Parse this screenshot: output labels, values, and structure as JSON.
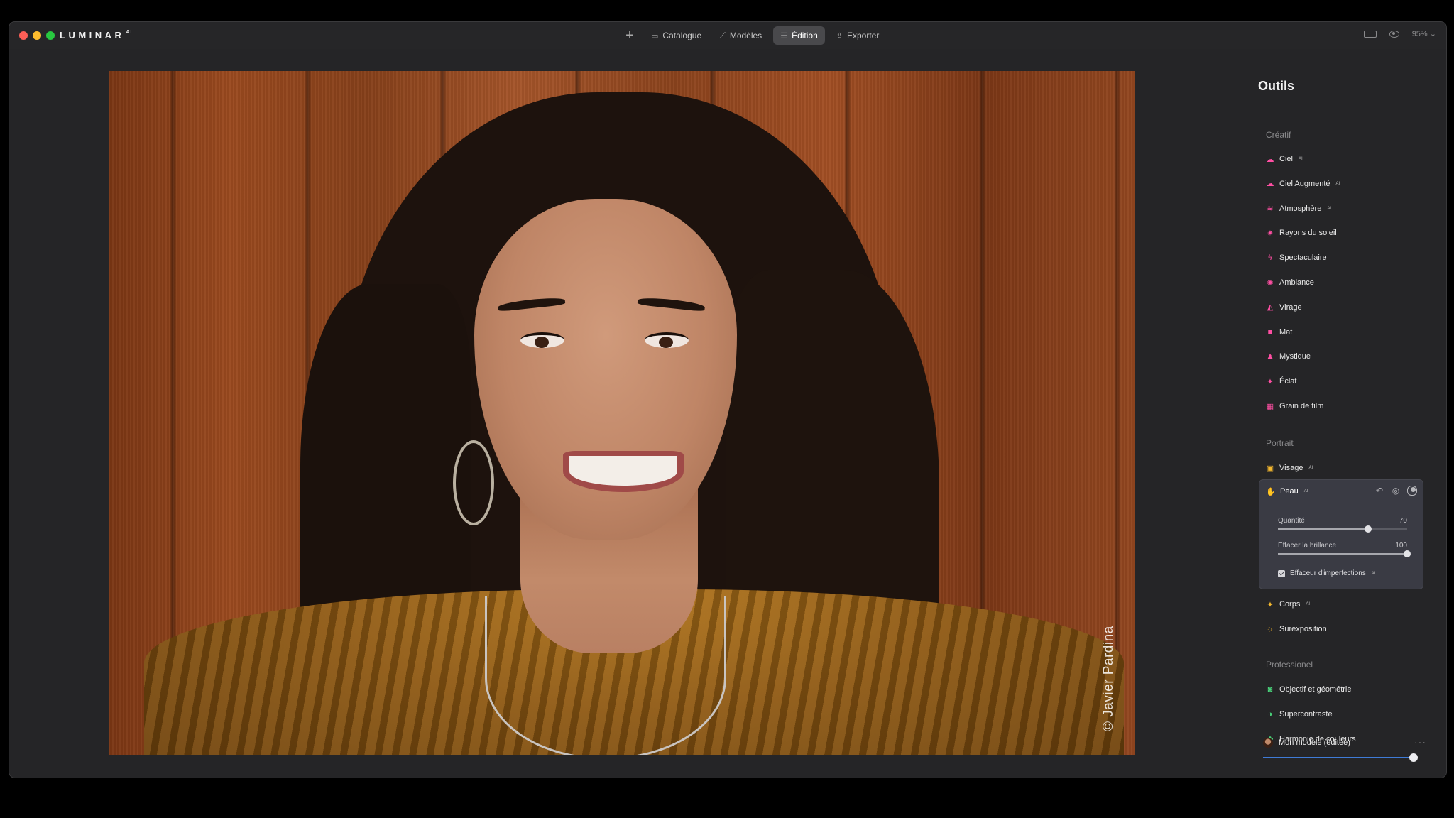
{
  "app": {
    "brand": "LUMINAR",
    "brand_suffix": "AI"
  },
  "topnav": {
    "items": [
      {
        "label": "Catalogue",
        "icon": "folder-icon"
      },
      {
        "label": "Modèles",
        "icon": "wand-icon"
      },
      {
        "label": "Édition",
        "icon": "sliders-icon",
        "active": true
      },
      {
        "label": "Exporter",
        "icon": "share-icon"
      }
    ],
    "zoom": "95%"
  },
  "photo": {
    "watermark": "© Javier Pardina"
  },
  "panel": {
    "title": "Outils",
    "sections": {
      "creatif": {
        "label": "Créatif",
        "items": [
          {
            "label": "Ciel",
            "ai": true,
            "color": "#ff4fa3"
          },
          {
            "label": "Ciel Augmenté",
            "ai": true,
            "color": "#ff4fa3"
          },
          {
            "label": "Atmosphère",
            "ai": true,
            "color": "#ff4fa3"
          },
          {
            "label": "Rayons du soleil",
            "ai": false,
            "color": "#ff4fa3"
          },
          {
            "label": "Spectaculaire",
            "ai": false,
            "color": "#ff4fa3"
          },
          {
            "label": "Ambiance",
            "ai": false,
            "color": "#ff4fa3"
          },
          {
            "label": "Virage",
            "ai": false,
            "color": "#ff4fa3"
          },
          {
            "label": "Mat",
            "ai": false,
            "color": "#ff4fa3"
          },
          {
            "label": "Mystique",
            "ai": false,
            "color": "#ff4fa3"
          },
          {
            "label": "Éclat",
            "ai": false,
            "color": "#ff4fa3"
          },
          {
            "label": "Grain de film",
            "ai": false,
            "color": "#ff4fa3"
          }
        ]
      },
      "portrait": {
        "label": "Portrait",
        "items": [
          {
            "label": "Visage",
            "ai": true,
            "color": "#f5b82e"
          },
          {
            "label": "Corps",
            "ai": true,
            "color": "#f5b82e"
          },
          {
            "label": "Surexposition",
            "ai": false,
            "color": "#f5b82e"
          }
        ],
        "expanded": {
          "label": "Peau",
          "ai": true,
          "sliders": [
            {
              "label": "Quantité",
              "value": 70,
              "max": 100
            },
            {
              "label": "Effacer la brillance",
              "value": 100,
              "max": 100
            }
          ],
          "checkbox": {
            "label": "Effaceur d'imperfections",
            "ai": true,
            "checked": true
          }
        }
      },
      "professionnel": {
        "label": "Professionel",
        "items": [
          {
            "label": "Objectif et géométrie",
            "ai": false,
            "color": "#49d27a"
          },
          {
            "label": "Supercontraste",
            "ai": false,
            "color": "#49d27a"
          },
          {
            "label": "Harmonie de couleurs",
            "ai": false,
            "color": "#49d27a"
          }
        ]
      }
    },
    "model": {
      "label": "Mon modèle (éditée)",
      "amount": 100
    }
  },
  "ai_tag": "AI"
}
